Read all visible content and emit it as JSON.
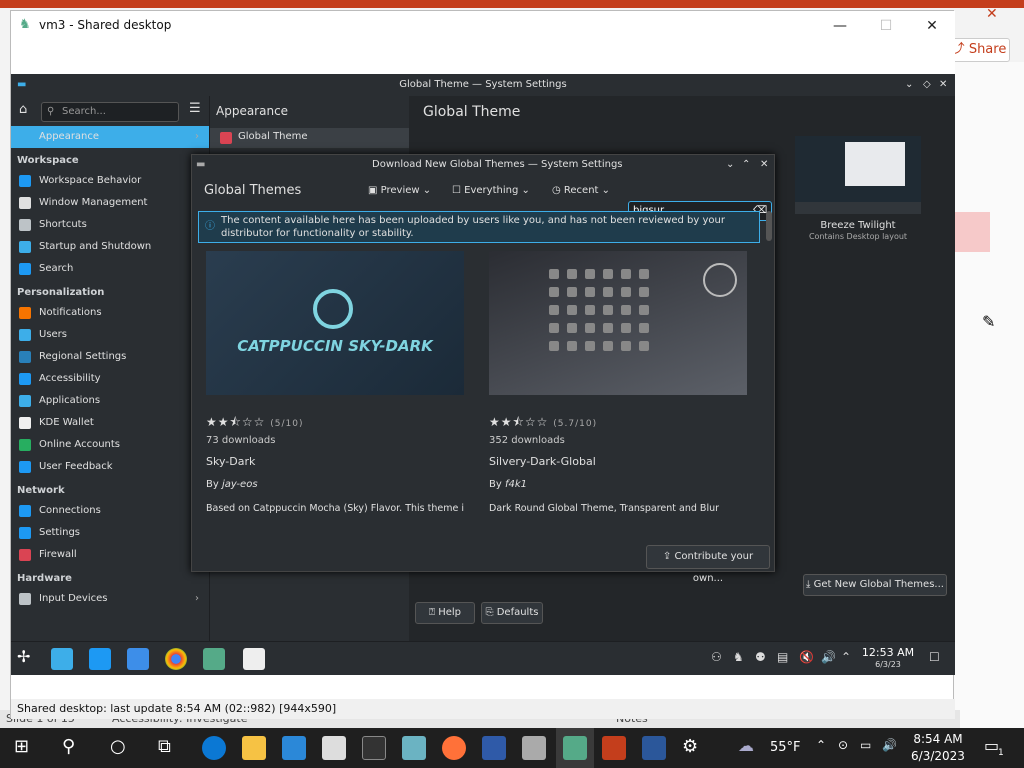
{
  "host": {
    "share_label": "Share",
    "status_left": "Slide 1 of 15",
    "status_accessibility": "Accessibility: Investigate",
    "notes_label": "Notes"
  },
  "vm_window": {
    "title": "vm3 - Shared desktop",
    "status": "Shared desktop: last update 8:54 AM (02::982) [944x590]",
    "minimize": "—",
    "maximize": "☐",
    "close": "✕"
  },
  "system_settings": {
    "window_title": "Global Theme — System Settings",
    "search_placeholder": "Search...",
    "section_header": "Appearance",
    "page_title": "Global Theme",
    "sub_item": "Global Theme",
    "nav": [
      {
        "type": "item",
        "label": "Appearance",
        "selected": true,
        "icon": "appearance-icon",
        "color": "#3daee9",
        "chevron": true
      },
      {
        "type": "section",
        "label": "Workspace"
      },
      {
        "type": "item",
        "label": "Workspace Behavior",
        "icon": "workspace-icon",
        "color": "#1d99f3",
        "chevron": true
      },
      {
        "type": "item",
        "label": "Window Management",
        "icon": "window-icon",
        "color": "#e0e0e0",
        "chevron": true
      },
      {
        "type": "item",
        "label": "Shortcuts",
        "icon": "keyboard-icon",
        "color": "#bdc3c7",
        "chevron": true
      },
      {
        "type": "item",
        "label": "Startup and Shutdown",
        "icon": "power-icon",
        "color": "#3daee9",
        "chevron": true
      },
      {
        "type": "item",
        "label": "Search",
        "icon": "search-icon",
        "color": "#1d99f3",
        "chevron": true
      },
      {
        "type": "section",
        "label": "Personalization"
      },
      {
        "type": "item",
        "label": "Notifications",
        "icon": "bell-icon",
        "color": "#f67400",
        "chevron": false
      },
      {
        "type": "item",
        "label": "Users",
        "icon": "users-icon",
        "color": "#3daee9",
        "chevron": false
      },
      {
        "type": "item",
        "label": "Regional Settings",
        "icon": "globe-icon",
        "color": "#2980b9",
        "chevron": true
      },
      {
        "type": "item",
        "label": "Accessibility",
        "icon": "accessibility-icon",
        "color": "#1d99f3",
        "chevron": false
      },
      {
        "type": "item",
        "label": "Applications",
        "icon": "applications-icon",
        "color": "#3daee9",
        "chevron": true
      },
      {
        "type": "item",
        "label": "KDE Wallet",
        "icon": "wallet-icon",
        "color": "#f0f0f0",
        "chevron": false
      },
      {
        "type": "item",
        "label": "Online Accounts",
        "icon": "online-accounts-icon",
        "color": "#27ae60",
        "chevron": false
      },
      {
        "type": "item",
        "label": "User Feedback",
        "icon": "feedback-icon",
        "color": "#1d99f3",
        "chevron": false
      },
      {
        "type": "section",
        "label": "Network"
      },
      {
        "type": "item",
        "label": "Connections",
        "icon": "connections-icon",
        "color": "#1d99f3",
        "chevron": false
      },
      {
        "type": "item",
        "label": "Settings",
        "icon": "network-settings-icon",
        "color": "#1d99f3",
        "chevron": true
      },
      {
        "type": "item",
        "label": "Firewall",
        "icon": "firewall-icon",
        "color": "#da4453",
        "chevron": false
      },
      {
        "type": "section",
        "label": "Hardware"
      },
      {
        "type": "item",
        "label": "Input Devices",
        "icon": "input-devices-icon",
        "color": "#bdc3c7",
        "chevron": true
      }
    ],
    "theme_preview_name": "Breeze Twilight",
    "theme_preview_desc": "Contains Desktop layout",
    "help_label": "Help",
    "defaults_label": "Defaults",
    "get_new_label": "Get New Global Themes..."
  },
  "dialog": {
    "title": "Download New Global Themes — System Settings",
    "heading": "Global Themes",
    "view_label": "Preview",
    "filter_label": "Everything",
    "sort_label": "Recent",
    "search_value": "bigsur",
    "warning": "The content available here has been uploaded by users like you, and has not been reviewed by your distributor for functionality or stability.",
    "contribute_label": "Contribute your own...",
    "cards": [
      {
        "image_text": "CATPPUCCIN SKY-DARK",
        "rating_text": "(5/10)",
        "rating": 0.5,
        "downloads": "73 downloads",
        "name": "Sky-Dark",
        "author_prefix": "By",
        "author": "jay-eos",
        "desc": "Based on Catppuccin Mocha (Sky) Flavor. This theme is"
      },
      {
        "image_text": "",
        "rating_text": "(5.7/10)",
        "rating": 0.57,
        "downloads": "352 downloads",
        "name": "Silvery-Dark-Global",
        "author_prefix": "By",
        "author": "f4k1",
        "desc": "Dark Round Global Theme, Transparent and Blur"
      }
    ]
  },
  "panel": {
    "time": "12:53 AM",
    "date": "6/3/23"
  },
  "win_taskbar": {
    "weather": "55°F",
    "time": "8:54 AM",
    "date": "6/3/2023",
    "notif_count": "1"
  }
}
